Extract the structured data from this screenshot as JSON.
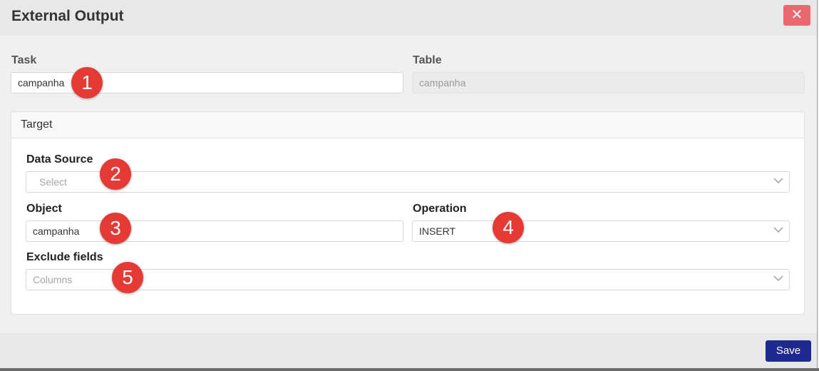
{
  "dialog": {
    "title": "External Output",
    "close_label": "✕"
  },
  "task": {
    "label": "Task",
    "value": "campanha"
  },
  "table": {
    "label": "Table",
    "value": "campanha"
  },
  "target": {
    "title": "Target",
    "data_source": {
      "label": "Data Source",
      "placeholder": "Select"
    },
    "object": {
      "label": "Object",
      "value": "campanha"
    },
    "operation": {
      "label": "Operation",
      "value": "INSERT"
    },
    "exclude_fields": {
      "label": "Exclude fields",
      "placeholder": "Columns"
    }
  },
  "markers": [
    "1",
    "2",
    "3",
    "4",
    "5"
  ],
  "colors": {
    "close": "#e8686d",
    "save": "#1f2a8f",
    "marker": "#e53935"
  },
  "footer": {
    "save_label": "Save"
  }
}
